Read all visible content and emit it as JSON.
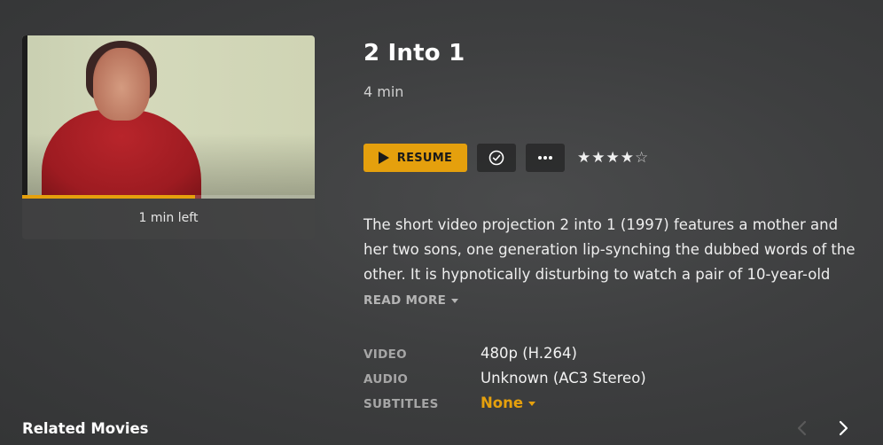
{
  "media": {
    "title": "2 Into 1",
    "duration": "4 min",
    "time_left": "1 min left",
    "progress_fraction": 0.59
  },
  "actions": {
    "resume_label": "RESUME",
    "resume_icon": "play-icon",
    "watched_icon": "check-circle-icon",
    "more_icon": "more-horizontal-icon"
  },
  "rating": {
    "stars_filled": 4,
    "stars_total": 5,
    "filled_glyph": "★★★★",
    "empty_glyph": "☆"
  },
  "summary": {
    "text": "The short video projection 2 into 1 (1997) features a mother and her two sons, one generation lip-synching the dubbed words of the other. It is hypnotically disturbing to watch a pair of 10-year-old",
    "read_more_label": "READ MORE"
  },
  "meta": {
    "video_label": "VIDEO",
    "video_value": "480p (H.264)",
    "audio_label": "AUDIO",
    "audio_value": "Unknown (AC3 Stereo)",
    "subtitles_label": "SUBTITLES",
    "subtitles_value": "None"
  },
  "related": {
    "title": "Related Movies",
    "prev_icon": "chevron-left-icon",
    "next_icon": "chevron-right-icon"
  },
  "colors": {
    "accent": "#e5a00d",
    "background": "#3e3f40"
  }
}
